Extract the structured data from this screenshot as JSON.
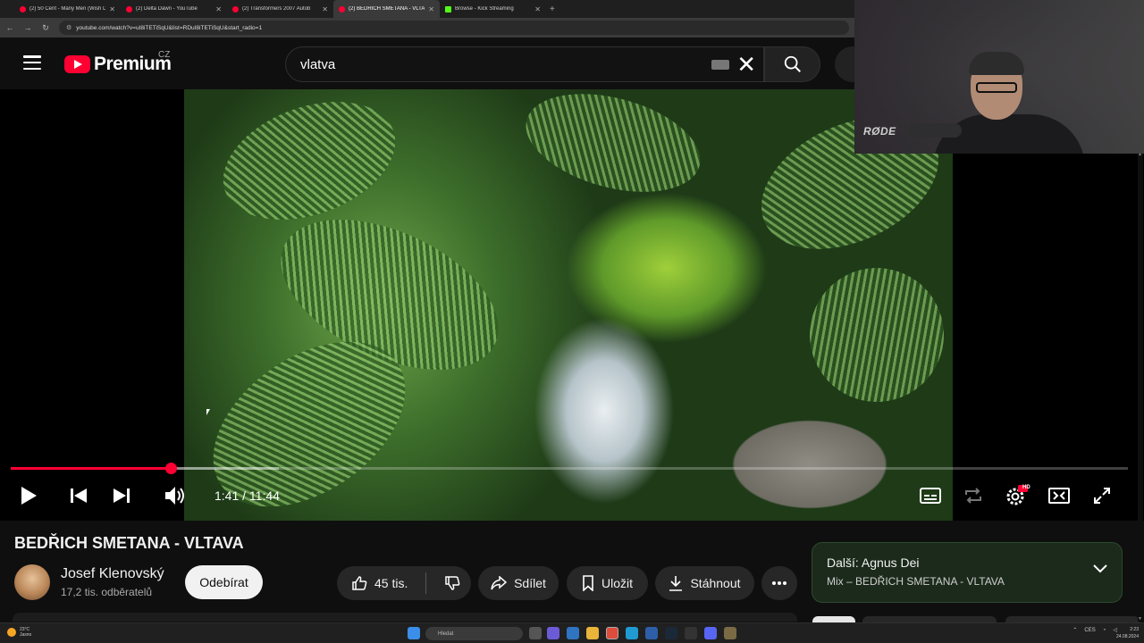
{
  "browser": {
    "tabs": [
      {
        "title": "(2) 50 Cent - Many Men (Wish D",
        "favicon": "youtube-icon"
      },
      {
        "title": "(2) Delta Dawn - YouTube",
        "favicon": "youtube-icon"
      },
      {
        "title": "(2) Transformers 2007 Autob",
        "favicon": "youtube-icon"
      },
      {
        "title": "(2) BEDŘICH SMETANA - VLTAV",
        "favicon": "youtube-icon",
        "active": true
      },
      {
        "title": "Browse - Kick Streaming",
        "favicon": "kick-icon"
      }
    ],
    "new_tab": "+",
    "url": "youtube.com/watch?v=uI8iTETiSqU&list=RDuI8iTETiSqU&start_radio=1"
  },
  "header": {
    "logo_text": "Premium",
    "country": "CZ",
    "search_value": "vlatva"
  },
  "webcam": {
    "mic_brand": "RØDE"
  },
  "player": {
    "current_time": "1:41",
    "duration": "11:44",
    "time_display": "1:41 / 11:44",
    "progress_fraction": 0.1435,
    "buffered_fraction": 0.24,
    "hd_badge": "HD"
  },
  "video": {
    "title": "BEDŘICH SMETANA - VLTAVA",
    "channel": "Josef Klenovský",
    "subscribers": "17,2 tis. odběratelů",
    "subscribe_label": "Odebírat",
    "likes": "45 tis.",
    "share_label": "Sdílet",
    "save_label": "Uložit",
    "download_label": "Stáhnout"
  },
  "up_next": {
    "title": "Další: Agnus Dei",
    "subtitle": "Mix – BEDŘICH SMETANA - VLTAVA"
  },
  "taskbar": {
    "search_placeholder": "Hledat",
    "language": "CES",
    "weather_temp": "23°C",
    "weather_desc": "Jasno",
    "time": "2:23",
    "date": "24.08.2024"
  },
  "colors": {
    "accent": "#ff0033",
    "background": "#0f0f0f"
  }
}
